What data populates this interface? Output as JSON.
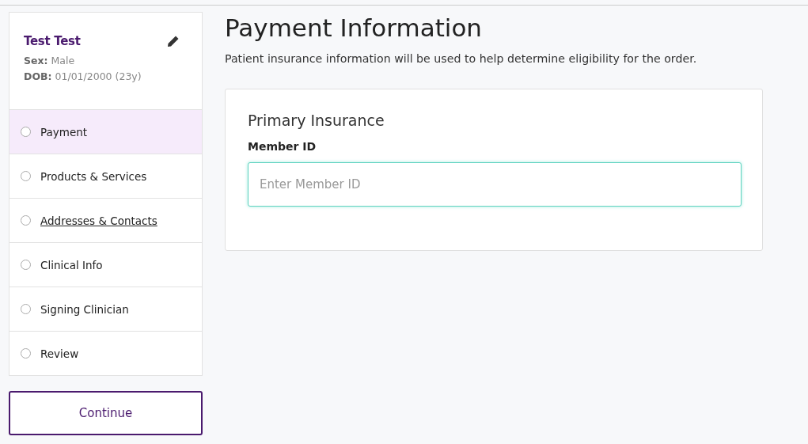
{
  "patient": {
    "name": "Test Test",
    "details": [
      {
        "label": "Sex:",
        "value": "Male"
      },
      {
        "label": "DOB:",
        "value": "01/01/2000 (23y)"
      }
    ]
  },
  "steps": [
    {
      "label": "Payment",
      "selected": true,
      "underlined": false
    },
    {
      "label": "Products & Services",
      "selected": false,
      "underlined": false
    },
    {
      "label": "Addresses & Contacts",
      "selected": false,
      "underlined": true
    },
    {
      "label": "Clinical Info",
      "selected": false,
      "underlined": false
    },
    {
      "label": "Signing Clinician",
      "selected": false,
      "underlined": false
    },
    {
      "label": "Review",
      "selected": false,
      "underlined": false
    }
  ],
  "continue_button": "Continue",
  "main": {
    "title": "Payment Information",
    "description": "Patient insurance information will be used to help determine eligibility for the order.",
    "card": {
      "title": "Primary Insurance",
      "field_label": "Member ID",
      "placeholder": "Enter Member ID"
    }
  }
}
